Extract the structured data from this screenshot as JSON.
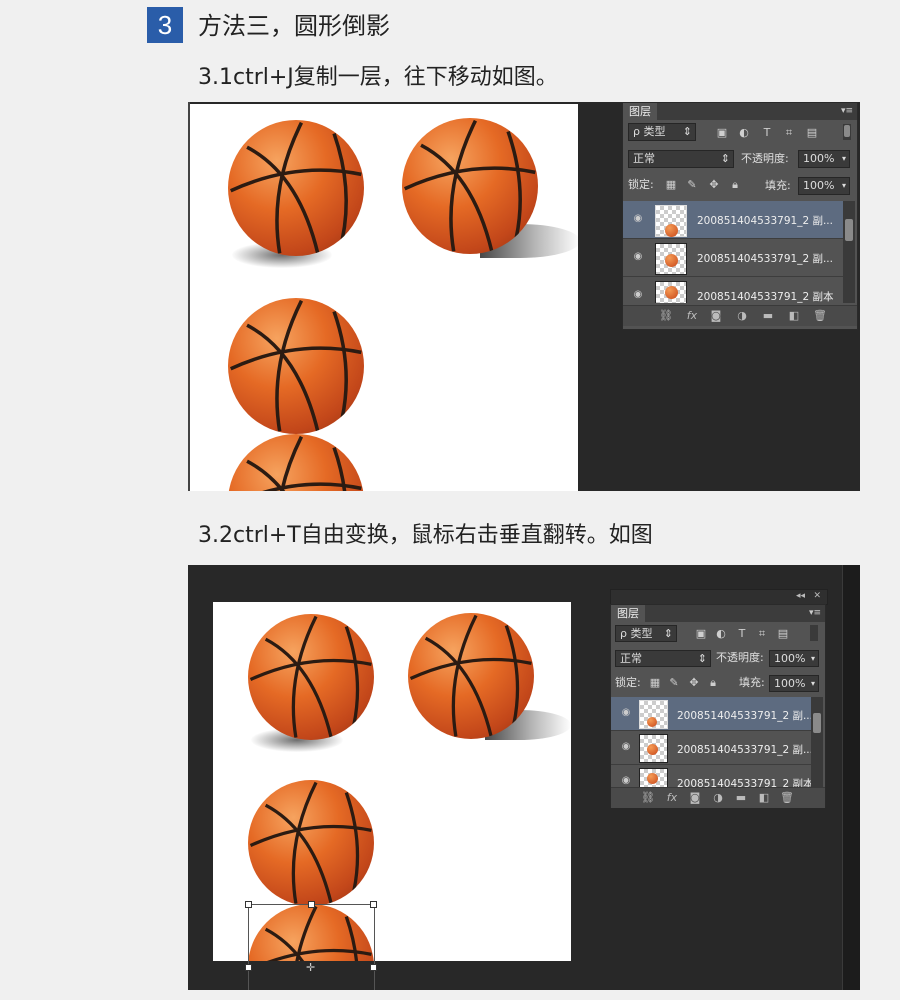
{
  "step": {
    "number": "3",
    "title": "方法三，圆形倒影"
  },
  "sub1": "3.1ctrl+J复制一层，往下移动如图。",
  "sub2": "3.2ctrl+T自由变换，鼠标右击垂直翻转。如图",
  "panel": {
    "tab": "图层",
    "menu_icon": "▾≡",
    "filter_label": "ρ 类型",
    "blend_mode": "正常",
    "opacity_label": "不透明度:",
    "opacity_value": "100%",
    "lock_label": "锁定:",
    "fill_label": "填充:",
    "fill_value": "100%",
    "layers": [
      {
        "name": "200851404533791_2 副..."
      },
      {
        "name": "200851404533791_2 副..."
      },
      {
        "name": "200851404533791_2 副本"
      }
    ],
    "icons": {
      "filter": [
        "image-filter-icon",
        "adjust-filter-icon",
        "text-filter-icon",
        "shape-filter-icon",
        "smart-filter-icon"
      ],
      "lock": [
        "lock-pixels-icon",
        "lock-brush-icon",
        "lock-move-icon",
        "lock-all-icon"
      ],
      "footer": [
        "link-icon",
        "fx-icon",
        "mask-icon",
        "adjustment-icon",
        "folder-icon",
        "new-layer-icon",
        "trash-icon"
      ]
    }
  },
  "colors": {
    "accent": "#2a5da9",
    "selected_layer": "#5d6b80",
    "panel_bg": "#535353",
    "workspace": "#282828",
    "ball": "#e56a25"
  }
}
